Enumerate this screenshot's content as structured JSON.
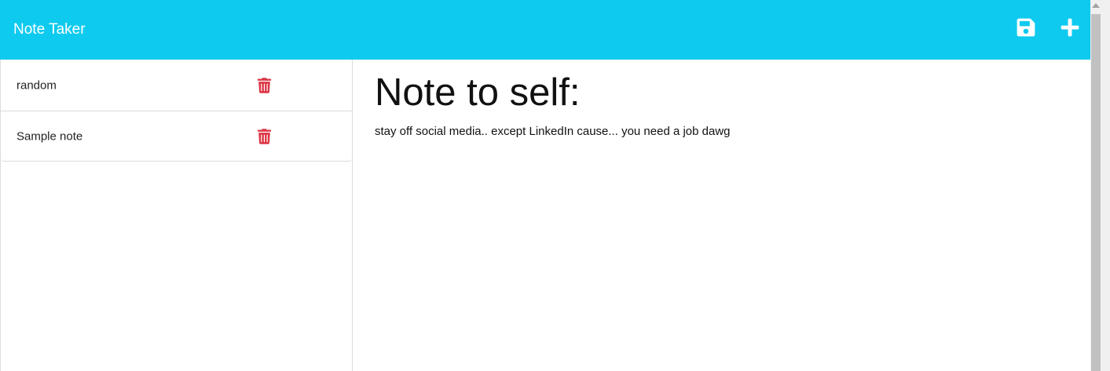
{
  "navbar": {
    "brand": "Note Taker",
    "save_icon": "save-icon",
    "new_icon": "plus-icon",
    "background": "#0ecaef"
  },
  "sidebar": {
    "notes": [
      {
        "title": "random",
        "delete_icon": "trash-icon"
      },
      {
        "title": "Sample note",
        "delete_icon": "trash-icon"
      }
    ],
    "delete_color": "#dc3545"
  },
  "editor": {
    "title": "Note to self:",
    "body": "stay off social media.. except LinkedIn cause... you need a job dawg"
  }
}
